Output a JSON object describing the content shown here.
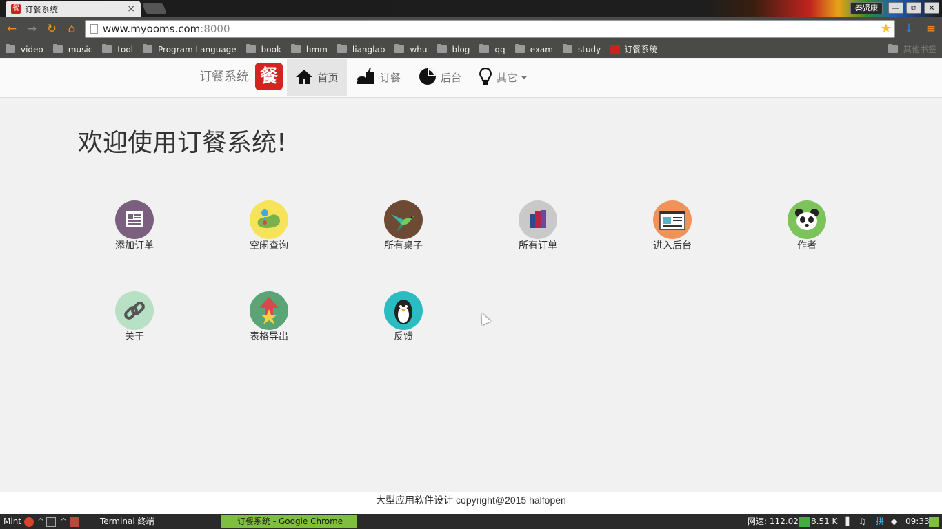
{
  "browser": {
    "tab_title": "订餐系统",
    "tab_close": "×",
    "user_name": "秦贤康",
    "window_buttons": [
      "—",
      "⧉",
      "✕"
    ],
    "url_host": "www.myooms.com",
    "url_port": ":8000",
    "bookmarks": [
      "video",
      "music",
      "tool",
      "Program Language",
      "book",
      "hmm",
      "lianglab",
      "whu",
      "blog",
      "qq",
      "exam",
      "study"
    ],
    "bookmark_site": "订餐系统",
    "other_bookmarks": "其他书签"
  },
  "navbar": {
    "brand": "订餐系统",
    "brand_logo_char": "餐",
    "items": [
      {
        "label": "首页",
        "active": true,
        "icon": "home-icon"
      },
      {
        "label": "订餐",
        "active": false,
        "icon": "food-icon"
      },
      {
        "label": "后台",
        "active": false,
        "icon": "pie-chart-icon"
      },
      {
        "label": "其它",
        "active": false,
        "icon": "lightbulb-icon"
      }
    ]
  },
  "main": {
    "welcome": "欢迎使用订餐系统!",
    "tiles": [
      {
        "label": "添加订单",
        "icon": "newspaper-icon",
        "color": "#7a5f7f"
      },
      {
        "label": "空闲查询",
        "icon": "map-pin-icon",
        "color": "#f6e35a"
      },
      {
        "label": "所有桌子",
        "icon": "hummingbird-icon",
        "color": "#6d4a33"
      },
      {
        "label": "所有订单",
        "icon": "books-icon",
        "color": "#c9c9c9"
      },
      {
        "label": "进入后台",
        "icon": "browser-window-icon",
        "color": "#f0935a"
      },
      {
        "label": "作者",
        "icon": "panda-icon",
        "color": "#7cc35c"
      },
      {
        "label": "关于",
        "icon": "link-icon",
        "color": "#b7e0c4"
      },
      {
        "label": "表格导出",
        "icon": "export-arrow-icon",
        "color": "#5aa476"
      },
      {
        "label": "反馈",
        "icon": "penguin-icon",
        "color": "#2bbcc1"
      }
    ]
  },
  "footer": {
    "text": "大型应用软件设计 copyright@2015 halfopen"
  },
  "taskbar": {
    "menu": "Mint",
    "terminal": "Terminal 终端",
    "chrome": "订餐系统 - Google Chrome",
    "net_label": "网速: 112.02 K",
    "net_up": "8.51 K",
    "ime": "拼",
    "clock": "09:33"
  }
}
